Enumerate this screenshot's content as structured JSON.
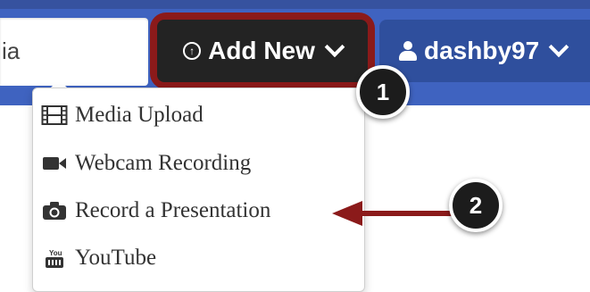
{
  "search": {
    "value": "ia"
  },
  "header": {
    "add_new_label": "Add New",
    "user_label": "dashby97"
  },
  "dropdown": {
    "items": [
      {
        "label": "Media Upload",
        "icon": "film-icon"
      },
      {
        "label": "Webcam Recording",
        "icon": "video-camera-icon"
      },
      {
        "label": "Record a Presentation",
        "icon": "camera-icon"
      },
      {
        "label": "YouTube",
        "icon": "youtube-icon"
      }
    ]
  },
  "callouts": {
    "first": "1",
    "second": "2"
  },
  "colors": {
    "topbar": "#3f63c0",
    "add_new_button": "#232323",
    "user_button": "#2f4f9d",
    "highlight": "#8b1a1a",
    "arrow": "#8b1a1a",
    "callout": "#1c1c1c"
  }
}
